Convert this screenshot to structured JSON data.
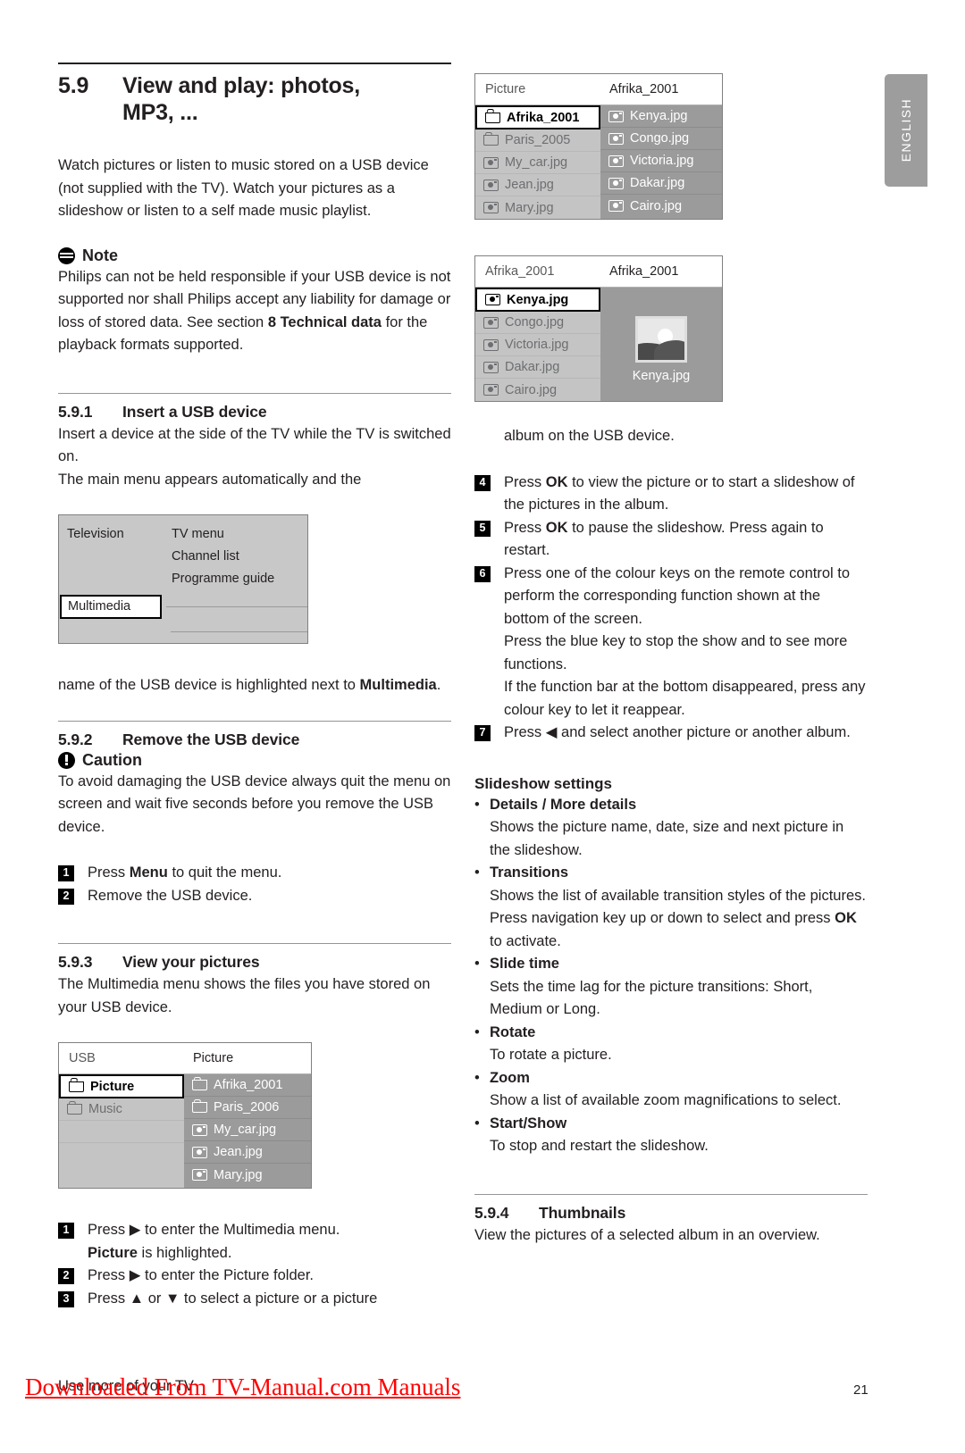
{
  "language_tab": "ENGLISH",
  "page_number": "21",
  "footer": {
    "running_head": "Use more of your TV",
    "watermark": "Downloaded From TV-Manual.com Manuals"
  },
  "left_column": {
    "section": {
      "number": "5.9",
      "title_line1": "View and play: photos,",
      "title_line2": "MP3, ..."
    },
    "intro": "Watch pictures or listen to music stored on a USB device (not supplied with the TV). Watch your pictures as a slideshow or listen to a self made music playlist.",
    "note": {
      "icon": "note-icon",
      "label": "Note",
      "text_a": "Philips can not be held responsible if your USB device is not supported nor shall Philips accept any liability for damage or loss of stored data. See section ",
      "text_bold": "8 Technical data",
      "text_b": " for the playback formats supported."
    },
    "s591": {
      "number": "5.9.1",
      "title": "Insert a USB device",
      "text": "Insert a device at the side of the TV while the TV is switched on.\nThe main menu appears automatically and the"
    },
    "main_menu": {
      "left_items": [
        "Television"
      ],
      "right_items": [
        "TV menu",
        "Channel list",
        "Programme guide"
      ],
      "selected_item": "Multimedia"
    },
    "after_menu": {
      "text_a": "name of the USB device is highlighted next to ",
      "text_bold": "Multimedia",
      "text_b": "."
    },
    "s592": {
      "number": "5.9.2",
      "title": "Remove the USB device",
      "caution_icon": "caution-icon",
      "caution_label": "Caution",
      "caution_text": "To avoid damaging the USB device always quit the menu on screen and wait five seconds before you remove the USB device.",
      "steps": [
        {
          "num": "1",
          "pre": "Press ",
          "bold": "Menu",
          "post": " to quit the menu."
        },
        {
          "num": "2",
          "pre": "Remove the USB device.",
          "bold": "",
          "post": ""
        }
      ]
    },
    "s593": {
      "number": "5.9.3",
      "title": "View your pictures",
      "text": "The Multimedia menu shows the files you have stored on your USB device."
    },
    "usb_menu": {
      "header_left": "USB",
      "header_right": "Picture",
      "left_items": [
        {
          "icon": "folder-icon",
          "label": "Picture",
          "selected": true
        },
        {
          "icon": "folder-icon",
          "label": "Music",
          "selected": false
        }
      ],
      "right_items": [
        {
          "icon": "folder-icon",
          "label": "Afrika_2001"
        },
        {
          "icon": "folder-icon",
          "label": "Paris_2006"
        },
        {
          "icon": "camera-icon",
          "label": "My_car.jpg"
        },
        {
          "icon": "camera-icon",
          "label": "Jean.jpg"
        },
        {
          "icon": "camera-icon",
          "label": "Mary.jpg"
        }
      ]
    },
    "steps_123": [
      {
        "num": "1",
        "line1_pre": "Press ",
        "line1_arrow": "▶",
        "line1_post": " to enter the Multimedia menu.",
        "line2_bold": "Picture",
        "line2_post": " is highlighted."
      },
      {
        "num": "2",
        "line1_pre": "Press ",
        "line1_arrow": "▶",
        "line1_post": " to enter the Picture folder.",
        "line2_bold": "",
        "line2_post": ""
      },
      {
        "num": "3",
        "line1_pre": "Press ",
        "line1_arrow": "▲",
        "line1_mid": " or ",
        "line1_arrow2": "▼",
        "line1_post": " to select a picture or a picture",
        "line2_bold": "",
        "line2_post": ""
      }
    ]
  },
  "right_column": {
    "picture_menu": {
      "header_left": "Picture",
      "header_right": "Afrika_2001",
      "left_items": [
        {
          "icon": "folder-icon",
          "label": "Afrika_2001",
          "selected": true
        },
        {
          "icon": "folder-icon",
          "label": "Paris_2005",
          "selected": false
        },
        {
          "icon": "camera-icon",
          "label": "My_car.jpg",
          "selected": false
        },
        {
          "icon": "camera-icon",
          "label": "Jean.jpg",
          "selected": false
        },
        {
          "icon": "camera-icon",
          "label": "Mary.jpg",
          "selected": false
        }
      ],
      "right_items": [
        {
          "icon": "camera-icon",
          "label": "Kenya.jpg"
        },
        {
          "icon": "camera-icon",
          "label": "Congo.jpg"
        },
        {
          "icon": "camera-icon",
          "label": "Victoria.jpg"
        },
        {
          "icon": "camera-icon",
          "label": "Dakar.jpg"
        },
        {
          "icon": "camera-icon",
          "label": "Cairo.jpg"
        }
      ]
    },
    "album_menu": {
      "header_left": "Afrika_2001",
      "header_right": "Afrika_2001",
      "left_items": [
        {
          "icon": "camera-icon",
          "label": "Kenya.jpg",
          "selected": true
        },
        {
          "icon": "camera-icon",
          "label": "Congo.jpg",
          "selected": false
        },
        {
          "icon": "camera-icon",
          "label": "Victoria.jpg",
          "selected": false
        },
        {
          "icon": "camera-icon",
          "label": "Dakar.jpg",
          "selected": false
        },
        {
          "icon": "camera-icon",
          "label": "Cairo.jpg",
          "selected": false
        }
      ],
      "preview_caption": "Kenya.jpg"
    },
    "continuation": "album on the USB device.",
    "steps": [
      {
        "num": "4",
        "pre": "Press ",
        "bold": "OK",
        "post": " to view the picture or to start a slideshow of the pictures in the album."
      },
      {
        "num": "5",
        "pre": "Press ",
        "bold": "OK",
        "post": " to pause the slideshow. Press again to restart."
      },
      {
        "num": "6",
        "pre": "Press one of the colour keys on the remote control to perform the corresponding function shown at the bottom of the screen.\nPress the blue key to stop the show and to see more functions.\nIf the function bar at the bottom disappeared, press any colour key to let it reappear.",
        "bold": "",
        "post": ""
      },
      {
        "num": "7",
        "pre": "Press ◀ and select another picture or another album.",
        "bold": "",
        "post": ""
      }
    ],
    "slideshow": {
      "heading": "Slideshow settings",
      "items": [
        {
          "title": "Details / More details",
          "desc": "Shows the picture name, date, size and next picture in the slideshow."
        },
        {
          "title": "Transitions",
          "desc": "Shows the list of available transition styles of the pictures.",
          "desc2_pre": "Press navigation key up or down to select and press ",
          "desc2_bold": "OK",
          "desc2_post": " to activate."
        },
        {
          "title": "Slide time",
          "desc": "Sets the time lag for the picture transitions: Short, Medium or Long."
        },
        {
          "title": "Rotate",
          "desc": "To rotate a picture."
        },
        {
          "title": "Zoom",
          "desc": "Show a list of available zoom magnifications to select."
        },
        {
          "title": "Start/Show",
          "desc": "To stop and restart the slideshow."
        }
      ]
    },
    "s594": {
      "number": "5.9.4",
      "title": "Thumbnails",
      "text": "View the pictures of a selected album in an overview."
    }
  }
}
